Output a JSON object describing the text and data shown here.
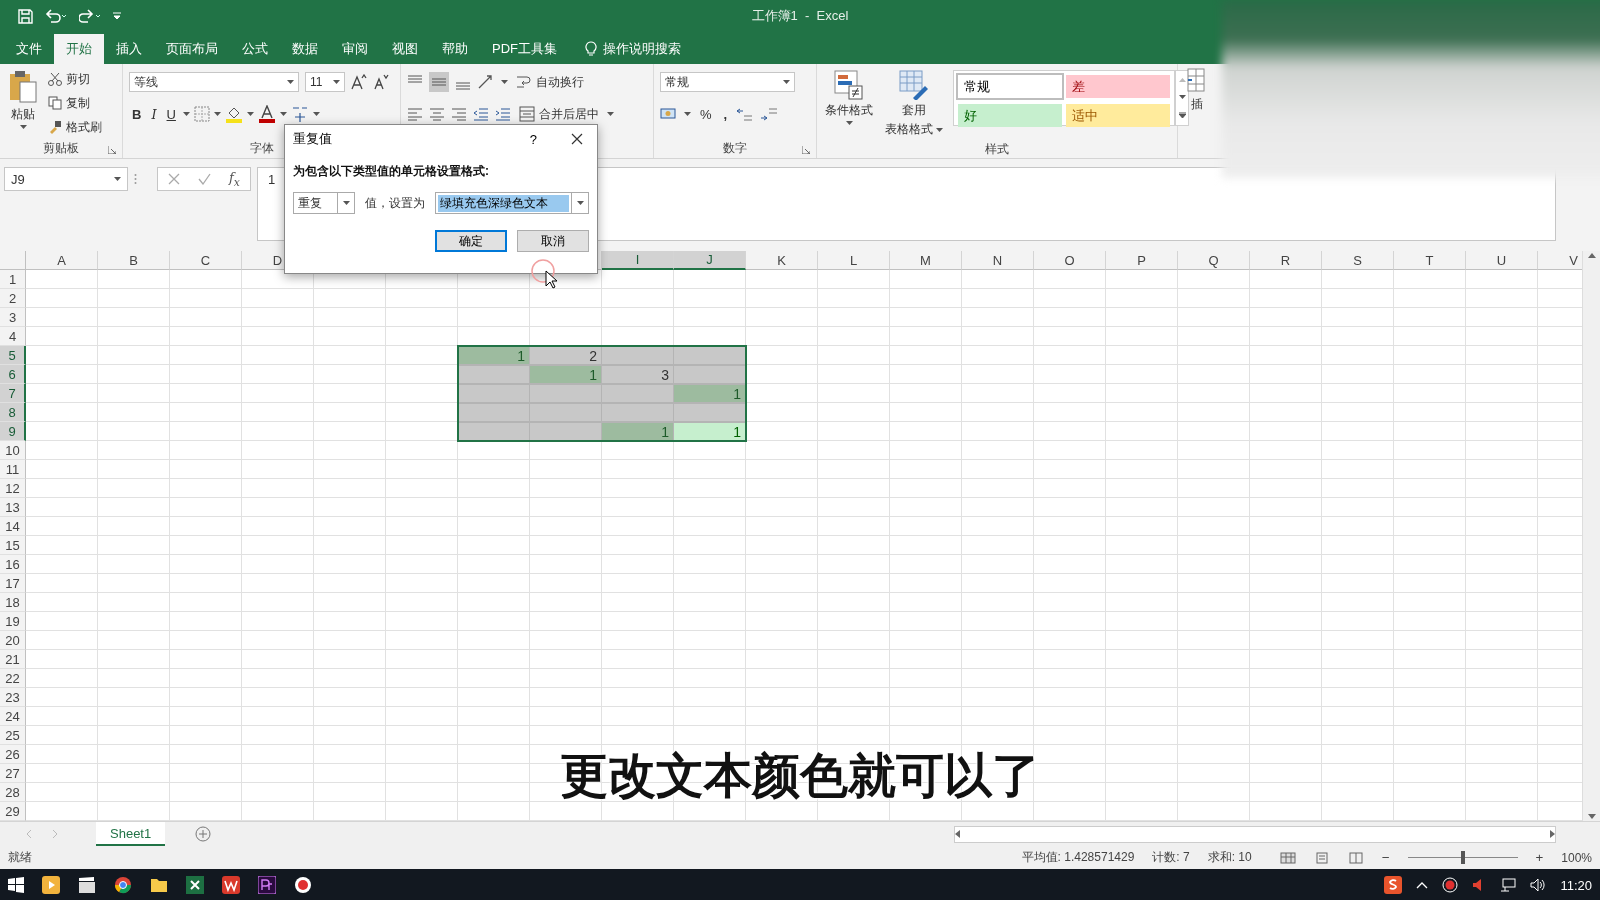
{
  "window": {
    "title": "工作簿1  -  Excel"
  },
  "menu_tabs": [
    {
      "label": "文件",
      "selected": false
    },
    {
      "label": "开始",
      "selected": true
    },
    {
      "label": "插入",
      "selected": false
    },
    {
      "label": "页面布局",
      "selected": false
    },
    {
      "label": "公式",
      "selected": false
    },
    {
      "label": "数据",
      "selected": false
    },
    {
      "label": "审阅",
      "selected": false
    },
    {
      "label": "视图",
      "selected": false
    },
    {
      "label": "帮助",
      "selected": false
    },
    {
      "label": "PDF工具集",
      "selected": false
    }
  ],
  "tell_me": "操作说明搜索",
  "ribbon": {
    "clipboard": {
      "paste": "粘贴",
      "cut": "剪切",
      "copy": "复制",
      "format_painter": "格式刷",
      "label": "剪贴板"
    },
    "font": {
      "name": "等线",
      "size": "11",
      "bold": "B",
      "italic": "I",
      "underline": "U",
      "label": "字体"
    },
    "alignment": {
      "wrap_text": "自动换行",
      "merge": "合并后居中"
    },
    "number": {
      "format": "常规",
      "percent": "%",
      "comma": ",",
      "label": "数字"
    },
    "styles": {
      "conditional": "条件格式",
      "table_1": "套用",
      "table_2": "表格格式",
      "label": "样式",
      "gallery": [
        {
          "label": "常规",
          "kind": "normal"
        },
        {
          "label": "差",
          "kind": "bad"
        },
        {
          "label": "好",
          "kind": "good"
        },
        {
          "label": "适中",
          "kind": "neutral"
        }
      ]
    },
    "cells": {
      "insert": "插"
    }
  },
  "formula_bar": {
    "name_box": "J9",
    "fx": "f$_{x}$",
    "content": "1"
  },
  "dialog": {
    "title": "重复值",
    "help": "?",
    "prompt": "为包含以下类型值的单元格设置格式:",
    "rule": "重复",
    "value_label": "值，设置为",
    "format": "绿填充色深绿色文本",
    "ok": "确定",
    "cancel": "取消"
  },
  "sheet": {
    "columns": [
      {
        "label": "A",
        "selected": false
      },
      {
        "label": "B",
        "selected": false
      },
      {
        "label": "C",
        "selected": false
      },
      {
        "label": "D",
        "selected": false
      },
      {},
      {},
      {},
      {},
      {
        "label": "I",
        "selected": true
      },
      {
        "label": "J",
        "selected": true
      },
      {
        "label": "K",
        "selected": false
      },
      {
        "label": "L",
        "selected": false
      },
      {
        "label": "M",
        "selected": false
      },
      {
        "label": "N",
        "selected": false
      },
      {
        "label": "O",
        "selected": false
      },
      {
        "label": "P",
        "selected": false
      },
      {
        "label": "Q",
        "selected": false
      },
      {
        "label": "R",
        "selected": false
      },
      {
        "label": "S",
        "selected": false
      },
      {
        "label": "T",
        "selected": false
      },
      {
        "label": "U",
        "selected": false
      },
      {
        "label": "V",
        "selected": false
      }
    ],
    "rows": [
      {
        "number": "1",
        "selected": false
      },
      {
        "number": "2",
        "selected": false
      },
      {
        "number": "3",
        "selected": false
      },
      {
        "number": "4",
        "selected": false
      },
      {
        "number": "5",
        "selected": true,
        "cells": [
          {
            "value": "1",
            "highlighted": true,
            "active": false
          },
          {
            "value": "2",
            "highlighted": false,
            "active": false
          },
          {
            "highlighted": false,
            "active": false
          },
          {
            "highlighted": false,
            "active": false
          }
        ]
      },
      {
        "number": "6",
        "selected": true,
        "cells": [
          {
            "highlighted": false,
            "active": false
          },
          {
            "value": "1",
            "highlighted": true,
            "active": false
          },
          {
            "value": "3",
            "highlighted": false,
            "active": false
          },
          {
            "highlighted": false,
            "active": false
          }
        ]
      },
      {
        "number": "7",
        "selected": true,
        "cells": [
          {
            "highlighted": false,
            "active": false
          },
          {
            "highlighted": false,
            "active": false
          },
          {
            "highlighted": false,
            "active": false
          },
          {
            "value": "1",
            "highlighted": true,
            "active": false
          }
        ]
      },
      {
        "number": "8",
        "selected": true,
        "cells": [
          {
            "highlighted": false,
            "active": false
          },
          {
            "highlighted": false,
            "active": false
          },
          {
            "highlighted": false,
            "active": false
          },
          {
            "highlighted": false,
            "active": false
          }
        ]
      },
      {
        "number": "9",
        "selected": true,
        "cells": [
          {
            "highlighted": false,
            "active": false
          },
          {
            "highlighted": false,
            "active": false
          },
          {
            "value": "1",
            "highlighted": true,
            "active": false
          },
          {
            "value": "1",
            "highlighted": true,
            "active": true
          }
        ]
      },
      {
        "number": "10",
        "selected": false
      },
      {
        "number": "11",
        "selected": false
      },
      {
        "number": "12",
        "selected": false
      },
      {
        "number": "13",
        "selected": false
      },
      {
        "number": "14",
        "selected": false
      },
      {
        "number": "15",
        "selected": false
      },
      {
        "number": "16",
        "selected": false
      },
      {
        "number": "17",
        "selected": false
      },
      {
        "number": "18",
        "selected": false
      },
      {
        "number": "19",
        "selected": false
      },
      {
        "number": "20",
        "selected": false
      },
      {
        "number": "21",
        "selected": false
      },
      {
        "number": "22",
        "selected": false
      },
      {
        "number": "23",
        "selected": false
      },
      {
        "number": "24",
        "selected": false
      },
      {
        "number": "25",
        "selected": false
      },
      {
        "number": "26",
        "selected": false
      },
      {
        "number": "27",
        "selected": false
      },
      {
        "number": "28",
        "selected": false
      },
      {
        "number": "29",
        "selected": false
      }
    ]
  },
  "sheet_tabs": [
    {
      "label": "Sheet1",
      "selected": true
    }
  ],
  "status_bar": {
    "mode": "就绪",
    "average": "平均值: 1.428571429",
    "count": "计数: 7",
    "sum": "求和: 10",
    "zoom_out": "−",
    "zoom_slider": {
      "level": 0.5
    },
    "zoom_in": "+",
    "zoom": "100%"
  },
  "taskbar": {
    "time": "11:20"
  },
  "subtitle": "更改文本颜色就可以了"
}
